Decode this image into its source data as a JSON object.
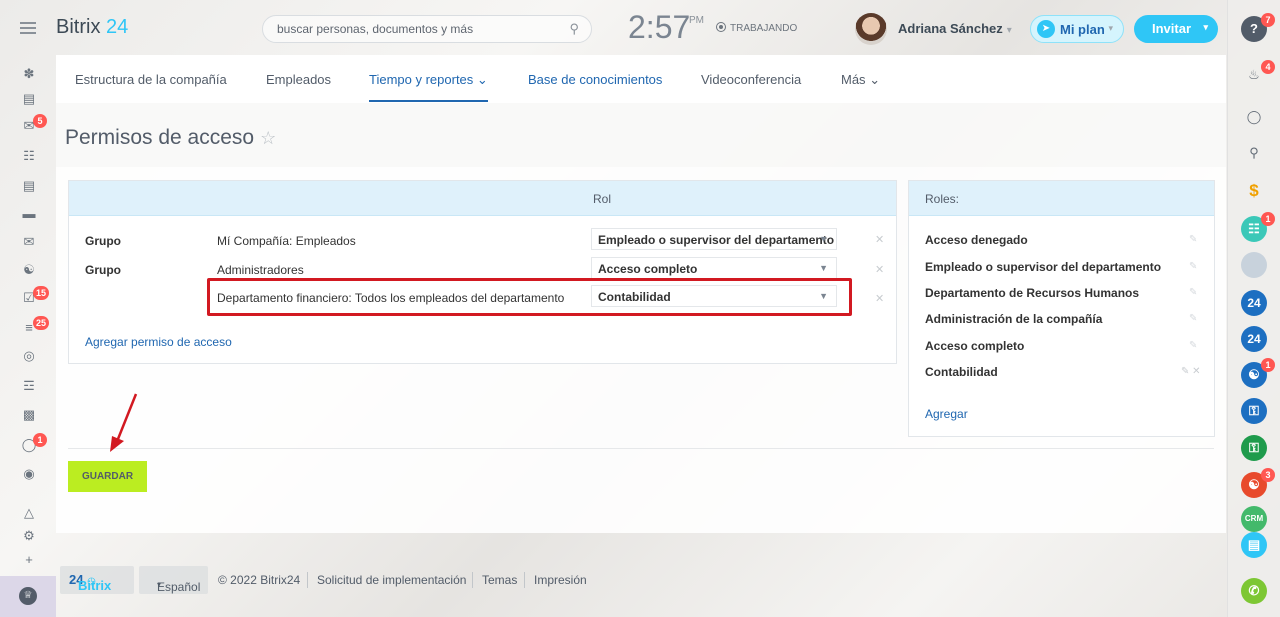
{
  "header": {
    "logo_text": "Bitrix",
    "logo_num": "24",
    "search_placeholder": "buscar personas, documentos y más",
    "clock": "2:57",
    "ampm": "PM",
    "status": "TRABAJANDO",
    "user_name": "Adriana Sánchez",
    "plan_label": "Mi plan",
    "invite_label": "Invitar"
  },
  "left_badges": {
    "chat": "5",
    "tasks": "15",
    "crm": "25",
    "robot": "1"
  },
  "right_badges": {
    "help": "7",
    "notifications": "4",
    "cal": "1",
    "group1": "1",
    "group2": "3"
  },
  "nav": {
    "items": [
      "Estructura de la compañía",
      "Empleados",
      "Tiempo y reportes",
      "Base de conocimientos",
      "Videoconferencia",
      "Más"
    ],
    "active": "Tiempo y reportes"
  },
  "page_title": "Permisos de acceso",
  "permissions": {
    "header": "Rol",
    "rows": [
      {
        "group": "Grupo",
        "name": "Mí Compañía: Empleados",
        "role": "Empleado o supervisor del departamento"
      },
      {
        "group": "Grupo",
        "name": "Administradores",
        "role": "Acceso completo"
      },
      {
        "group": "",
        "name": "Departamento financiero: Todos los empleados del departamento",
        "role": "Contabilidad"
      }
    ],
    "add_link": "Agregar permiso de acceso"
  },
  "roles": {
    "header": "Roles:",
    "items": [
      "Acceso denegado",
      "Empleado o supervisor del departamento",
      "Departamento de Recursos Humanos",
      "Administración de la compañía",
      "Acceso completo",
      "Contabilidad"
    ],
    "add_label": "Agregar"
  },
  "save_label": "GUARDAR",
  "footer": {
    "logo": "Bitrix",
    "logo_num": "24",
    "language": "Español",
    "copyright": "© 2022 Bitrix24",
    "implementation": "Solicitud de implementación",
    "themes": "Temas",
    "print": "Impresión"
  },
  "colors": {
    "accent": "#2fc6f6",
    "link": "#2067b0",
    "save": "#bbed21",
    "highlight": "#d21921",
    "badge": "#ff5752"
  }
}
